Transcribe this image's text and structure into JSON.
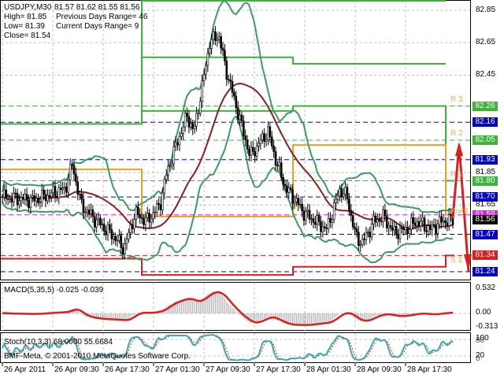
{
  "header": {
    "symbol": "USDJPY,M30",
    "ohlc": "81.57 81.62 81.55 81.56",
    "high": "High= 81.85",
    "low": "Low= 81.39",
    "close": "Close= 81.54",
    "prev_range": "Previous Days Range= 46",
    "cur_range": "Current Days Range= 9"
  },
  "price_axis": {
    "labels": [
      "82.85",
      "82.65",
      "82.45",
      "81.85",
      "81.65"
    ],
    "values": [
      82.85,
      82.65,
      82.45,
      81.85,
      81.65
    ]
  },
  "tags": [
    {
      "text": "82.26",
      "value": 82.26,
      "color": "#3cb43c"
    },
    {
      "text": "82.16",
      "value": 82.16,
      "color": "#0000c8"
    },
    {
      "text": "82.05",
      "value": 82.05,
      "color": "#3cb43c"
    },
    {
      "text": "81.93",
      "value": 81.93,
      "color": "#0000c8"
    },
    {
      "text": "81.80",
      "value": 81.8,
      "color": "#3cb43c"
    },
    {
      "text": "81.70",
      "value": 81.7,
      "color": "#0000c8"
    },
    {
      "text": "81.59",
      "value": 81.59,
      "color": "#e020e0"
    },
    {
      "text": "81.56",
      "value": 81.56,
      "color": "#000000"
    },
    {
      "text": "81.47",
      "value": 81.47,
      "color": "#0000c8"
    },
    {
      "text": "81.34",
      "value": 81.34,
      "color": "#dc1e1e"
    },
    {
      "text": "81.24",
      "value": 81.24,
      "color": "#0000c8"
    }
  ],
  "pivot_labels": [
    {
      "text": "R 3",
      "value": 82.26
    },
    {
      "text": "R 2",
      "value": 82.05
    },
    {
      "text": "R 1",
      "value": 81.8
    },
    {
      "text": "Pivot",
      "value": 81.57
    },
    {
      "text": "S 1",
      "value": 81.27
    }
  ],
  "macd": {
    "label": "MACD(5,35,5) -0.025 -0.039",
    "axis": [
      "0.532",
      "0.00",
      "-0.313"
    ]
  },
  "stoch": {
    "label": "Stoch(10,3,3) 68.0000 55.6684",
    "axis": [
      "100",
      "80",
      "20",
      "0"
    ]
  },
  "copyright": "BMF-Meta, © 2001-2010 MetaQuotes Software Corp.",
  "time_axis": [
    "26 Apr 2011",
    "26 Apr 09:30",
    "26 Apr 17:30",
    "27 Apr 01:30",
    "27 Apr 09:30",
    "27 Apr 17:30",
    "28 Apr 01:30",
    "28 Apr 09:30",
    "28 Apr 17:30"
  ],
  "chart_data": {
    "type": "candlestick",
    "anchors": [
      [
        0,
        81.7
      ],
      [
        0.07,
        81.68
      ],
      [
        0.14,
        81.75
      ],
      [
        0.155,
        81.9
      ],
      [
        0.175,
        81.65
      ],
      [
        0.21,
        81.55
      ],
      [
        0.25,
        81.45
      ],
      [
        0.27,
        81.38
      ],
      [
        0.295,
        81.6
      ],
      [
        0.32,
        81.55
      ],
      [
        0.35,
        81.65
      ],
      [
        0.365,
        81.85
      ],
      [
        0.39,
        82.05
      ],
      [
        0.41,
        82.2
      ],
      [
        0.425,
        82.1
      ],
      [
        0.445,
        82.4
      ],
      [
        0.46,
        82.65
      ],
      [
        0.48,
        82.7
      ],
      [
        0.495,
        82.5
      ],
      [
        0.515,
        82.3
      ],
      [
        0.53,
        82.15
      ],
      [
        0.55,
        81.95
      ],
      [
        0.575,
        82.05
      ],
      [
        0.59,
        82.1
      ],
      [
        0.61,
        81.9
      ],
      [
        0.63,
        81.75
      ],
      [
        0.645,
        81.7
      ],
      [
        0.67,
        81.6
      ],
      [
        0.695,
        81.55
      ],
      [
        0.72,
        81.5
      ],
      [
        0.75,
        81.75
      ],
      [
        0.765,
        81.7
      ],
      [
        0.785,
        81.45
      ],
      [
        0.8,
        81.42
      ],
      [
        0.825,
        81.55
      ],
      [
        0.845,
        81.58
      ],
      [
        0.87,
        81.48
      ],
      [
        0.895,
        81.5
      ],
      [
        0.92,
        81.55
      ],
      [
        0.95,
        81.5
      ],
      [
        0.975,
        81.55
      ],
      [
        1,
        81.56
      ]
    ],
    "pivots": [
      {
        "day": "26 Apr",
        "R3": 82.15,
        "P": 81.87,
        "S1": 81.32
      },
      {
        "day": "27 Apr",
        "R3": 82.95,
        "R2": 82.56,
        "R1": 82.23,
        "P": 81.58,
        "S1": 81.22
      },
      {
        "day": "28 Apr",
        "R3": 82.95,
        "R2": 82.52,
        "R1": 82.26,
        "P": 82.02,
        "S1": 81.27
      },
      {
        "day": "29 Apr",
        "R1": 81.8,
        "P": 81.59,
        "S1": 81.34
      }
    ],
    "forecast_arrows": [
      [
        81.57,
        82.02
      ],
      [
        82.02,
        81.24
      ]
    ]
  }
}
